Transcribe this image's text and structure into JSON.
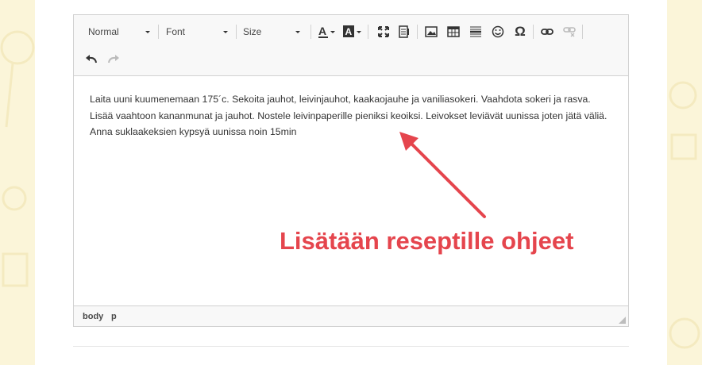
{
  "toolbar": {
    "format_label": "Normal",
    "font_label": "Font",
    "size_label": "Size"
  },
  "content": {
    "paragraph": "Laita uuni kuumenemaan 175´c. Sekoita jauhot, leivinjauhot, kaakaojauhe ja vaniliasokeri. Vaahdota sokeri ja rasva. Lisää vaahtoon kananmunat ja jauhot. Nostele leivinpaperille pieniksi keoiksi. Leivokset leviävät uunissa joten jätä väliä. Anna suklaakeksien kypsyä uunissa noin 15min"
  },
  "statusbar": {
    "crumbs": [
      "body",
      "p"
    ]
  },
  "annotation": {
    "text": "Lisätään reseptille ohjeet",
    "color": "#e5454d"
  },
  "colors": {
    "background": "#fbf5d9",
    "toolbar_bg": "#f8f8f8",
    "border": "#d1d1d1"
  }
}
